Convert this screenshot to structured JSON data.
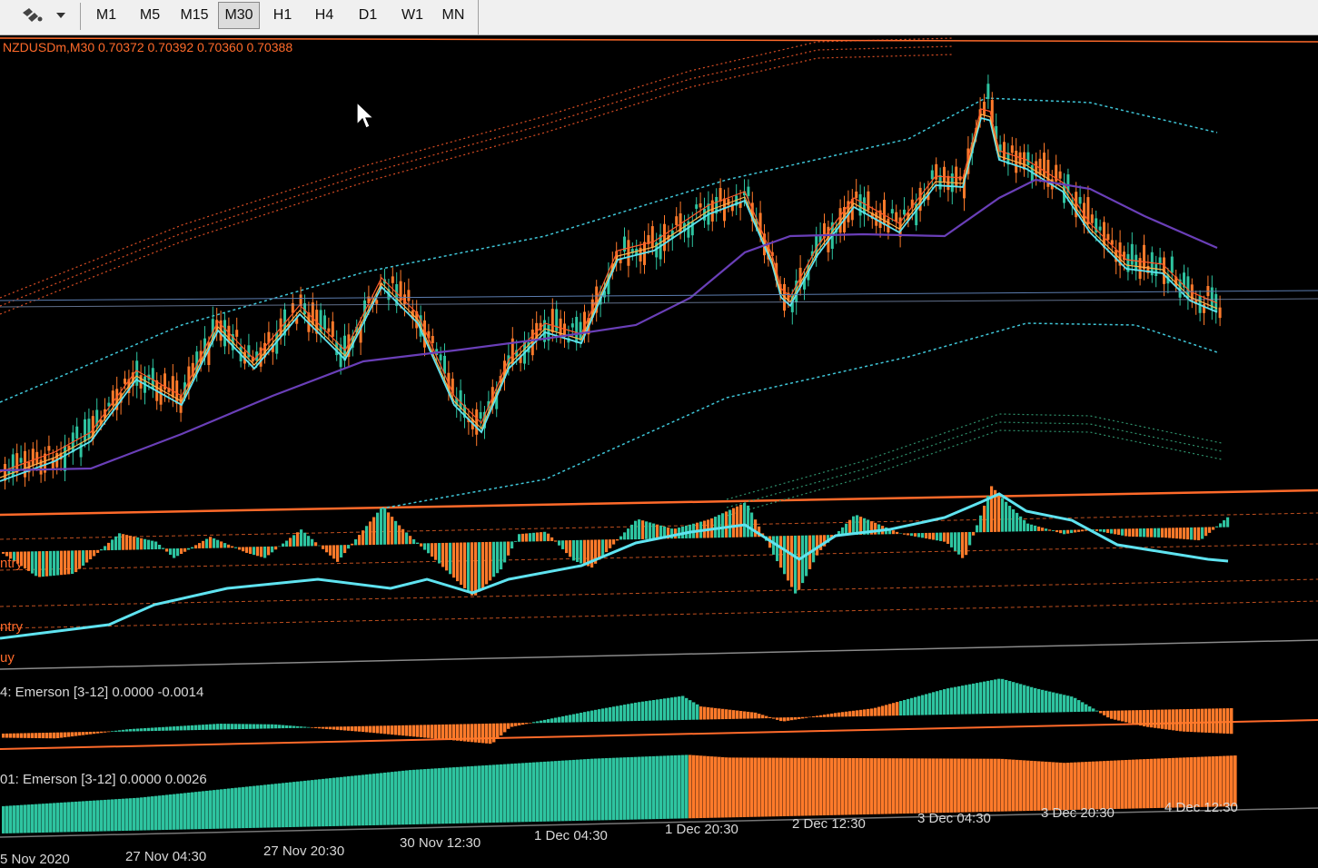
{
  "toolbar": {
    "timeframes": [
      "M1",
      "M5",
      "M15",
      "M30",
      "H1",
      "H4",
      "D1",
      "W1",
      "MN"
    ],
    "active_timeframe": "M30"
  },
  "chart": {
    "symbol_header": "NZDUSDm,M30  0.70372 0.70392 0.70360 0.70388",
    "indicator_1_label": "4: Emerson [3-12] 0.0000 -0.0014",
    "indicator_2_label": "01: Emerson [3-12] 0.0000 0.0026",
    "side_labels": [
      "ntry",
      "ntry",
      "uy"
    ],
    "time_axis": [
      "5 Nov 2020",
      "27 Nov 04:30",
      "27 Nov 20:30",
      "30 Nov 12:30",
      "1 Dec 04:30",
      "1 Dec 20:30",
      "2 Dec 12:30",
      "3 Dec 04:30",
      "3 Dec 20:30",
      "4 Dec 12:30"
    ]
  },
  "colors": {
    "background": "#000000",
    "bull": "#2ec4a0",
    "bear": "#ff7a2a",
    "ma_cyan": "#5fe3f0",
    "ma_purple": "#6a3fb8",
    "band_cyan": "#3fc6d8",
    "band_orange": "#ff5a2a",
    "band_green": "#2e8f6a",
    "separator": "#ff6a2a"
  },
  "icons": [
    "chart-tools-icon",
    "dropdown-arrow-icon",
    "mouse-cursor-icon"
  ]
}
